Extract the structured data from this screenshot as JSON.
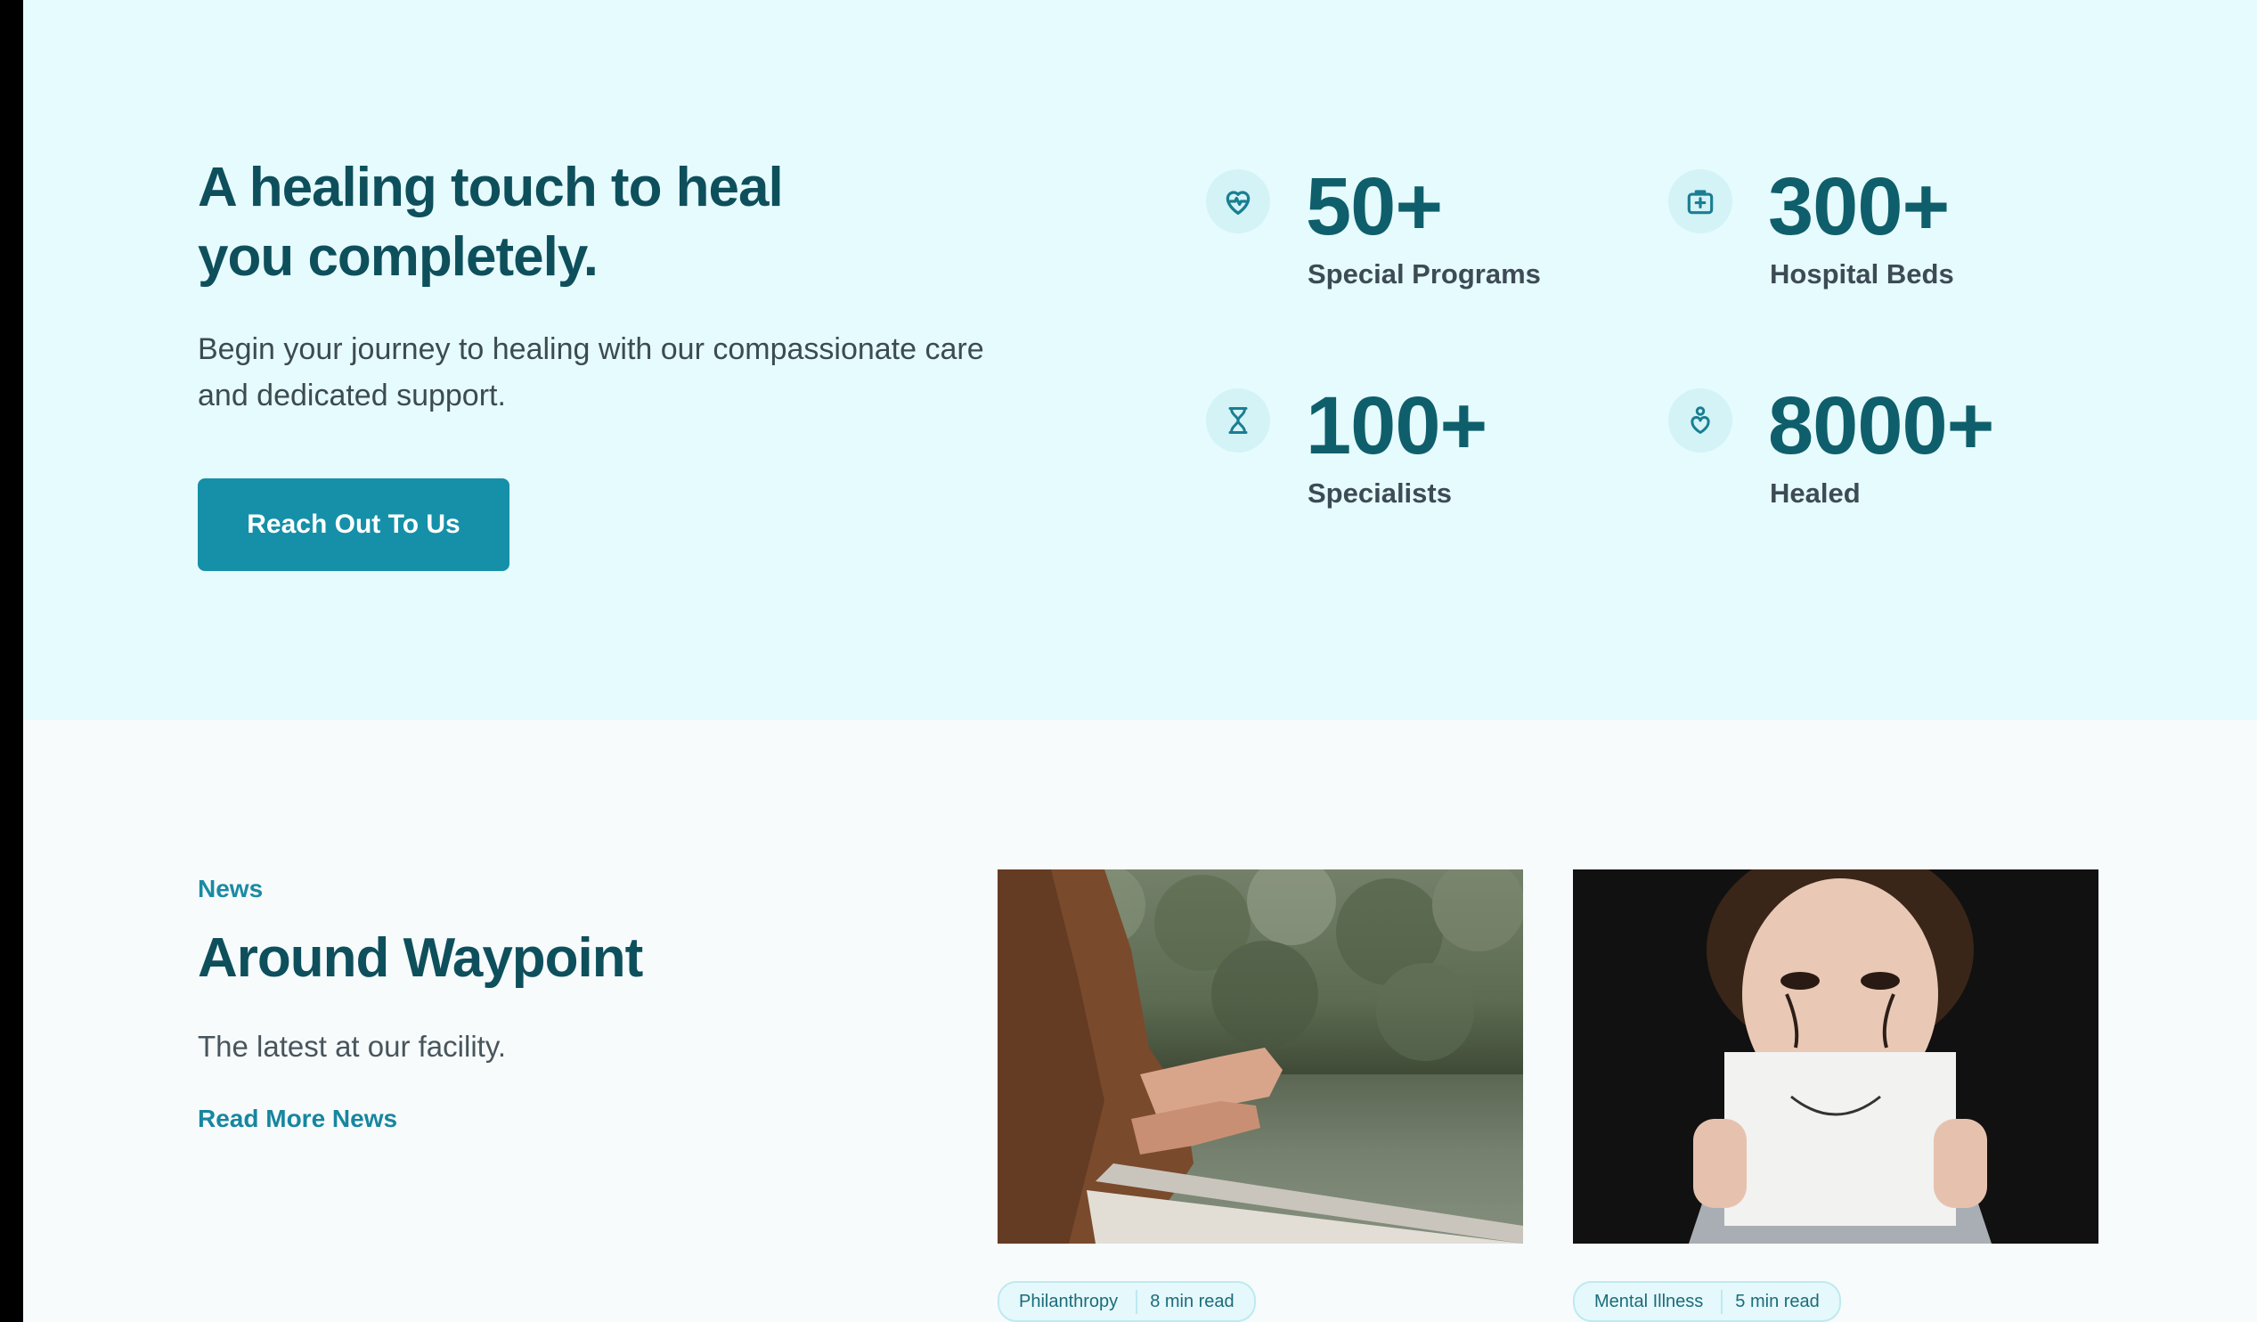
{
  "hero": {
    "title_line1": "A healing touch to heal",
    "title_line2": "you completely.",
    "desc_line1": "Begin your journey to healing with our compassionate care",
    "desc_line2": "and dedicated support.",
    "cta_label": "Reach Out To Us"
  },
  "stats": [
    {
      "icon": "heart-pulse-icon",
      "value": "50+",
      "label": "Special Programs"
    },
    {
      "icon": "medical-bag-icon",
      "value": "300+",
      "label": "Hospital Beds"
    },
    {
      "icon": "hourglass-icon",
      "value": "100+",
      "label": "Specialists"
    },
    {
      "icon": "person-heart-icon",
      "value": "8000+",
      "label": "Healed"
    }
  ],
  "news": {
    "eyebrow": "News",
    "title": "Around Waypoint",
    "desc": "The latest at our facility.",
    "link": "Read More News",
    "cards": [
      {
        "image": "person-by-lake-photo",
        "tag1": "Philanthropy",
        "tag2": "8 min read"
      },
      {
        "image": "woman-smile-sign-photo",
        "tag1": "Mental Illness",
        "tag2": "5 min read"
      }
    ]
  },
  "colors": {
    "hero_bg": "#e6fbfd",
    "heading": "#0e4f5c",
    "accent": "#1590a8",
    "stat_value": "#0e5f6b"
  }
}
